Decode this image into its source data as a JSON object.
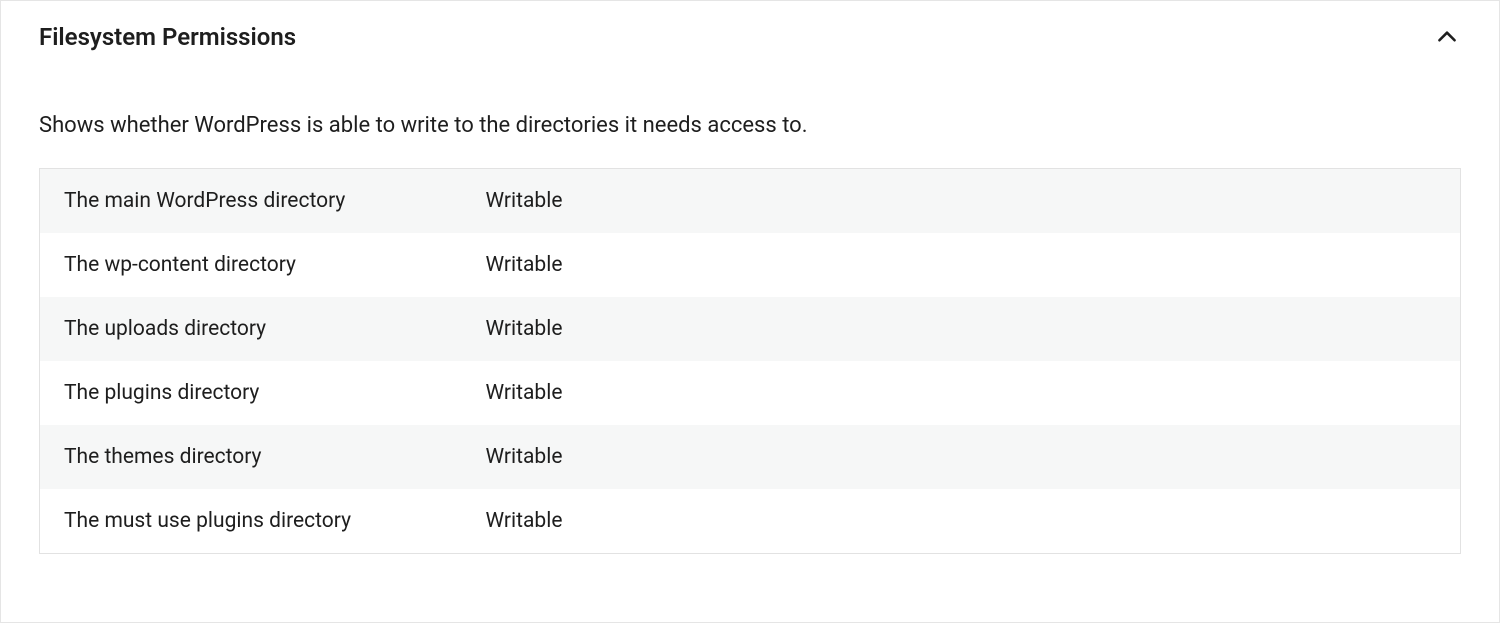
{
  "panel": {
    "title": "Filesystem Permissions",
    "description": "Shows whether WordPress is able to write to the directories it needs access to.",
    "rows": [
      {
        "label": "The main WordPress directory",
        "value": "Writable"
      },
      {
        "label": "The wp-content directory",
        "value": "Writable"
      },
      {
        "label": "The uploads directory",
        "value": "Writable"
      },
      {
        "label": "The plugins directory",
        "value": "Writable"
      },
      {
        "label": "The themes directory",
        "value": "Writable"
      },
      {
        "label": "The must use plugins directory",
        "value": "Writable"
      }
    ]
  }
}
